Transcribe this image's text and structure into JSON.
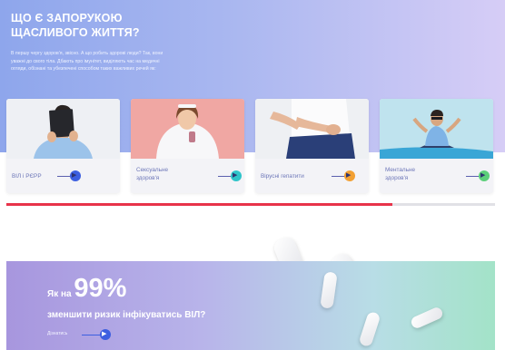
{
  "hero": {
    "title_lines": [
      "ЩО Є ЗАПОРУКОЮ",
      "ЩАСЛИВОГО ЖИТТЯ?"
    ],
    "text_lines": [
      "В першу чергу здоров'я, звісно. А що робить здорові люди? Так, вони",
      "уважні до свого тіла. Дбають про імунітет, виділяють час на медичні",
      "огляди, обізнані та убезпечені способом таких важливих речей як:"
    ],
    "background": "#a9b7f0"
  },
  "cards": [
    {
      "label_lines": [
        "ВІЛ і РЄРР"
      ],
      "accent": "#3d5fe0",
      "icon": "arrow-right-icon"
    },
    {
      "label_lines": [
        "Сексуальне",
        "здоров'я"
      ],
      "accent": "#2ec4c9",
      "icon": "arrow-right-icon"
    },
    {
      "label_lines": [
        "Вірусні гепатити"
      ],
      "accent": "#f2a033",
      "icon": "arrow-right-icon"
    },
    {
      "label_lines": [
        "Ментальне",
        "здоров'я"
      ],
      "accent": "#5ccf7a",
      "icon": "arrow-right-icon"
    }
  ],
  "progress": {
    "fraction": 0.79,
    "color": "#e8334a"
  },
  "banner": {
    "line1_prefix": "Як на ",
    "line1_percent": "99%",
    "line2": "зменшити ризик інфікуватись ВІЛ?",
    "cta_label": "Дізнатись",
    "cta_icon": "arrow-right-icon",
    "cta_color": "#3d5fe0"
  }
}
